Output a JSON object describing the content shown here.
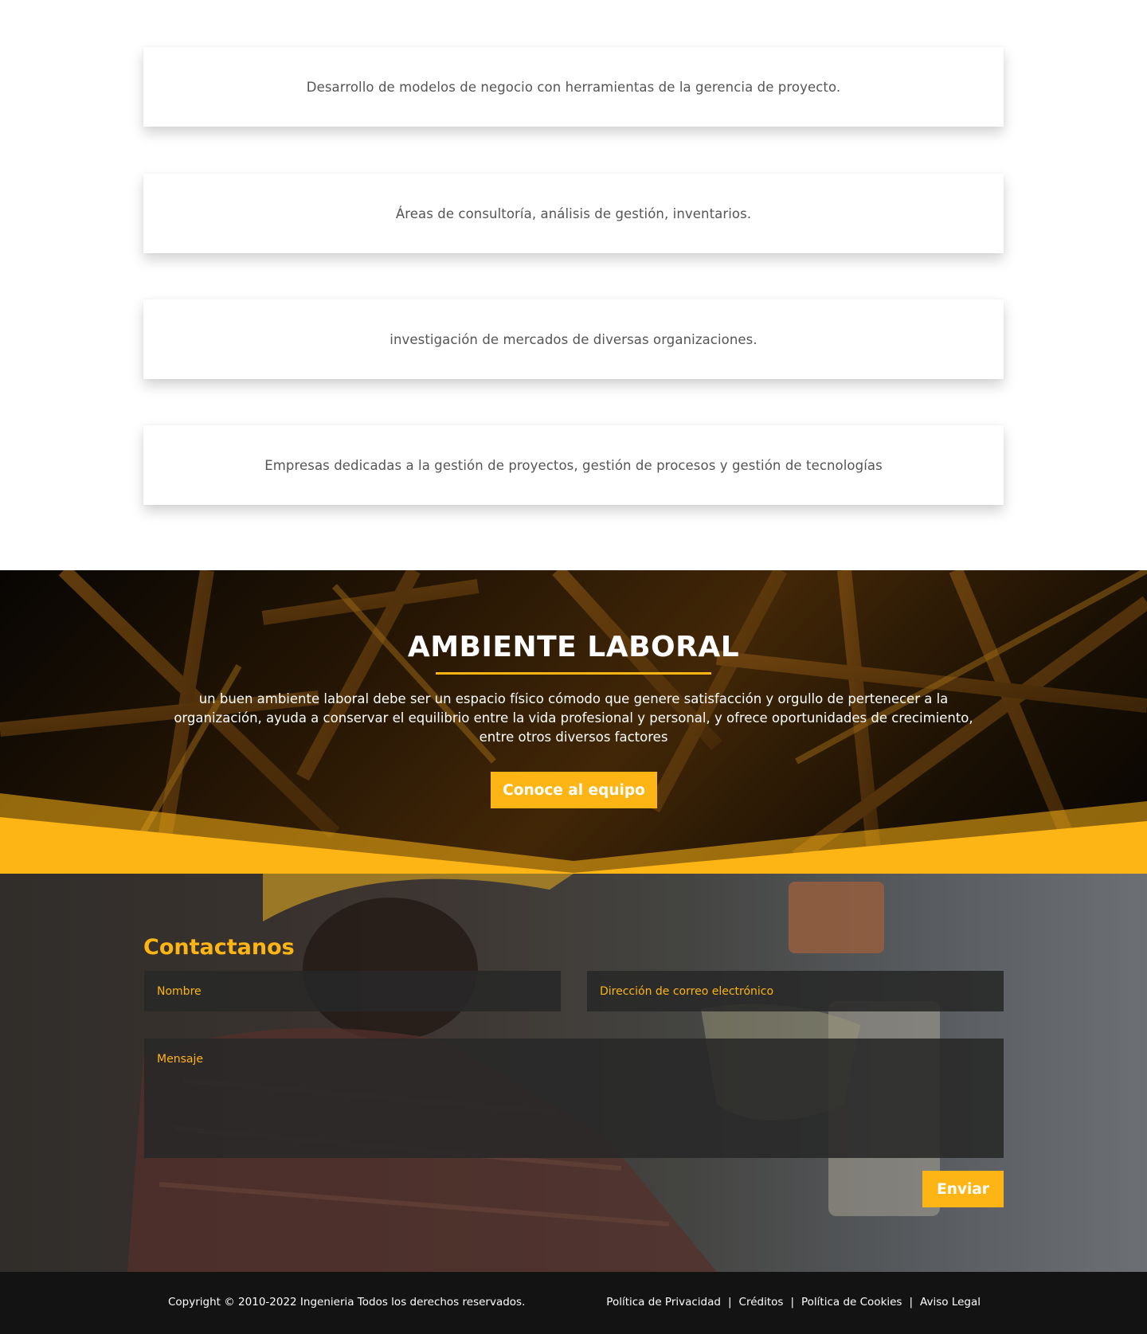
{
  "cards": [
    "Desarrollo de modelos de negocio con herramientas de la gerencia de proyecto.",
    "Áreas de consultoría, análisis de gestión, inventarios.",
    "investigación de mercados de diversas organizaciones.",
    "Empresas dedicadas a la gestión de proyectos, gestión de procesos y gestión de tecnologías"
  ],
  "hero": {
    "title": "AMBIENTE LABORAL",
    "text": "un buen ambiente laboral debe ser un espacio físico cómodo que genere satisfacción y orgullo de pertenecer a la organización, ayuda a conservar el equilibrio entre la vida profesional y personal, y ofrece oportunidades de crecimiento, entre otros diversos factores",
    "button": "Conoce al equipo"
  },
  "contact": {
    "title": "Contactanos",
    "name_placeholder": "Nombre",
    "email_placeholder": "Dirección de correo electrónico",
    "message_placeholder": "Mensaje",
    "submit": "Enviar"
  },
  "footer": {
    "copyright": "Copyright © 2010-2022 Ingenieria Todos los derechos reservados.",
    "links": [
      "Política de Privacidad",
      "Créditos",
      "Política de Cookies",
      "Aviso Legal"
    ],
    "separator": "|"
  },
  "colors": {
    "accent": "#fdb515",
    "footer_bg": "#131313",
    "card_text": "#555555"
  }
}
